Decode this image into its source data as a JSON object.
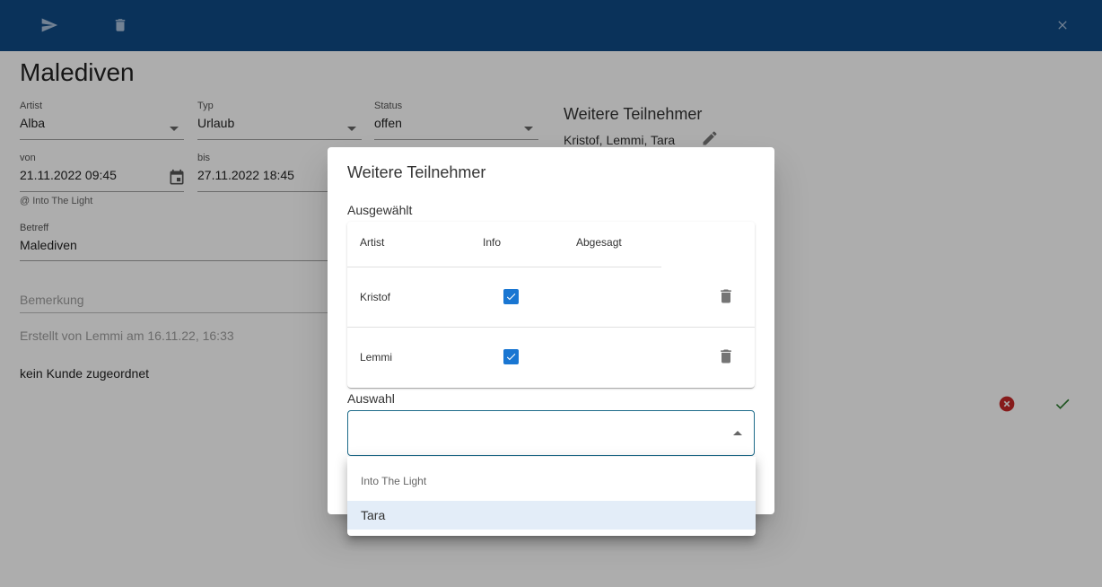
{
  "page": {
    "title": "Malediven",
    "fields": {
      "artist": {
        "label": "Artist",
        "value": "Alba"
      },
      "typ": {
        "label": "Typ",
        "value": "Urlaub"
      },
      "status": {
        "label": "Status",
        "value": "offen"
      },
      "von": {
        "label": "von",
        "value": "21.11.2022 09:45"
      },
      "bis": {
        "label": "bis",
        "value": "27.11.2022 18:45"
      },
      "betreff": {
        "label": "Betreff",
        "value": "Malediven"
      }
    },
    "location_hint": "@ Into The Light",
    "remark_placeholder": "Bemerkung",
    "created_text": "Erstellt von Lemmi am 16.11.22, 16:33",
    "customer_text": "kein Kunde zugeordnet",
    "participants": {
      "heading": "Weitere Teilnehmer",
      "names": "Kristof, Lemmi, Tara"
    }
  },
  "dialog": {
    "title": "Weitere Teilnehmer",
    "selected_label": "Ausgewählt",
    "columns": [
      "Artist",
      "Info",
      "Abgesagt"
    ],
    "rows": [
      {
        "artist": "Kristof",
        "info": true
      },
      {
        "artist": "Lemmi",
        "info": true
      }
    ],
    "selection_label": "Auswahl",
    "selection_value": ""
  },
  "dropdown": {
    "group": "Into The Light",
    "options": [
      "Tara"
    ]
  },
  "colors": {
    "toolbar": "#104b85",
    "primary": "#1976d2",
    "cancel": "#c62828",
    "confirm": "#2e7d32"
  }
}
